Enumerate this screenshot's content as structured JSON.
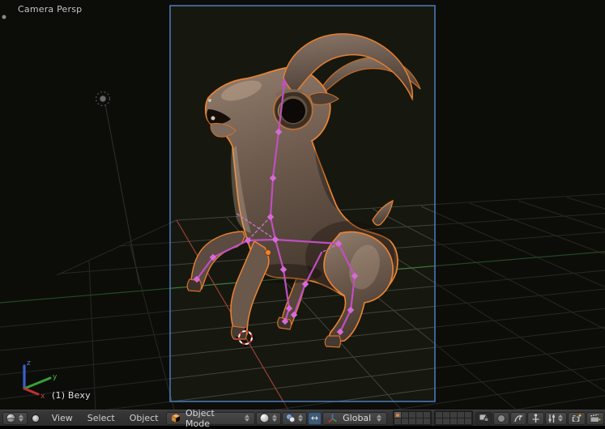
{
  "app": "Blender 3D Viewport",
  "viewport": {
    "view_label": "Camera Persp",
    "active_object_label": "(1) Bexy",
    "gizmo_axes": {
      "x": "x",
      "y": "y",
      "z": "z"
    }
  },
  "header": {
    "editor_type_icon": "3d-view-editor-icon",
    "menus": [
      "View",
      "Select",
      "Object"
    ],
    "mode_dropdown": {
      "label": "Object Mode",
      "icon": "object-mode-cube-icon"
    },
    "shading_dropdown": {
      "icon": "viewport-shading-sphere-icon"
    },
    "pivot_dropdown": {
      "icon": "pivot-point-icon"
    },
    "manipulator_toggle": {
      "glyph": "↔",
      "pressed": true
    },
    "orientation_dropdown": {
      "label": "Global",
      "icon": "axes-icon"
    },
    "layers": {
      "groups": 2,
      "rows": 2,
      "cols": 5,
      "active_group": 0,
      "active_cell": 0
    },
    "buttons": [
      "scene-lock",
      "proportional-editing",
      "proportional-falloff",
      "snap",
      "snap-element",
      "opengl-render-image",
      "opengl-render-animation"
    ]
  },
  "colors": {
    "selection_outline": "#ef8430",
    "bone": "#c04fc0",
    "camera_frame": "#4c7cc0",
    "grid_line": "#40443e",
    "axis_y_green": "#3f7d3f",
    "axis_x_red": "#9a4038",
    "header_bg": "#2f2f2f",
    "viewport_bg": "#171914"
  }
}
